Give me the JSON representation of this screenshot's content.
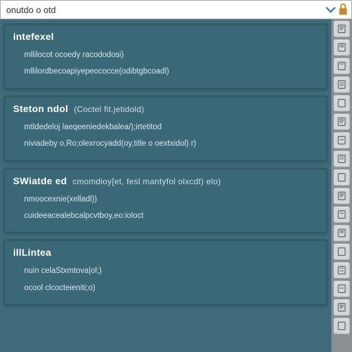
{
  "search": {
    "value": "onutdo o otd"
  },
  "results": [
    {
      "title": "intefexel",
      "meta": "",
      "snippets": [
        "mllilocot ocoedy racododosi)",
        "mllilordbecoapiyepeococce(odibtgbcoadl)"
      ]
    },
    {
      "title": "Steton ndol",
      "meta": "(Coctel fit.jetidold)",
      "snippets": [
        "mtldedeloj laeqeeniedekbalea/);irtetitod",
        "niviadeby o,Ro;olexrocyadd(oy,title o oextxidol) r)"
      ]
    },
    {
      "title": "SWiatde ed",
      "meta": "cmomdioy[et, fesl mantyfol olxcdt) elo)",
      "snippets": [
        "nmoocexnie(xelladl))",
        "cuideeacealebcalpcvtboy,eo:ioloct"
      ]
    },
    {
      "title": "illLintea",
      "meta": "",
      "snippets": [
        "nuin celaStxmtova|ol;)",
        "ocool clcocteieniti;o)"
      ]
    }
  ],
  "tools": [
    "doc-icon",
    "doc-icon",
    "doc-icon",
    "doc-icon",
    "doc-icon",
    "doc-icon",
    "doc-icon",
    "doc-icon",
    "doc-icon",
    "doc-icon",
    "doc-icon",
    "doc-icon",
    "doc-icon",
    "doc-icon",
    "doc-icon",
    "doc-icon",
    "doc-icon"
  ]
}
